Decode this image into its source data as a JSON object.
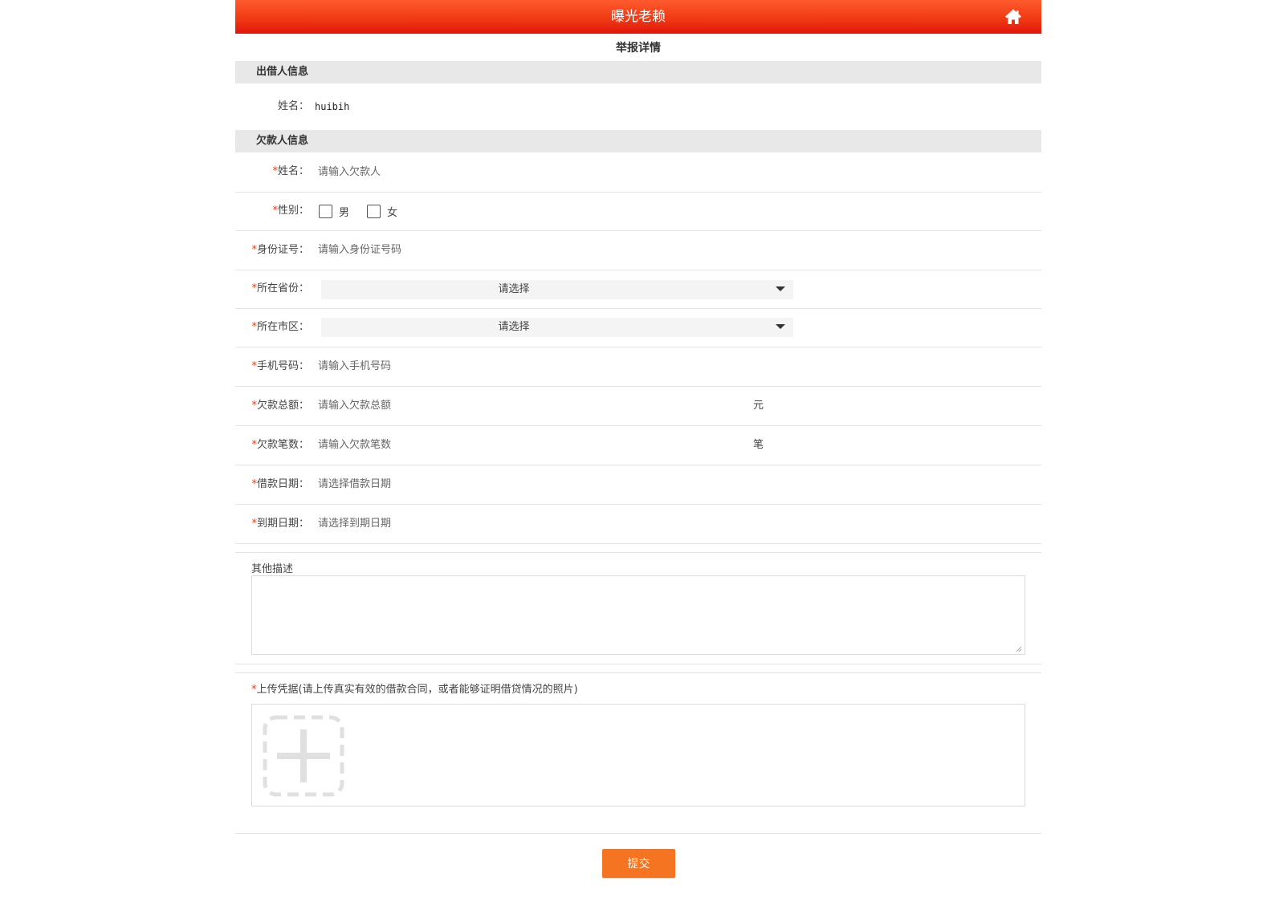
{
  "header": {
    "title": "曝光老赖",
    "home_icon": "home-icon",
    "gradient_colors": [
      "#ff5a2e",
      "#e0160e"
    ]
  },
  "subtitle": "举报详情",
  "lender_section": {
    "heading": "出借人信息",
    "name_label": "姓名：",
    "name_value": "huibih"
  },
  "debtor_section": {
    "heading": "欠款人信息",
    "required_mark": "*",
    "fields": {
      "name": {
        "label": "姓名：",
        "placeholder": "请输入欠款人"
      },
      "gender": {
        "label": "性别：",
        "options": [
          "男",
          "女"
        ]
      },
      "id_number": {
        "label": "身份证号：",
        "placeholder": "请输入身份证号码"
      },
      "province": {
        "label": "所在省份：",
        "selected": "请选择"
      },
      "city": {
        "label": "所在市区：",
        "selected": "请选择"
      },
      "phone": {
        "label": "手机号码：",
        "placeholder": "请输入手机号码"
      },
      "total_amount": {
        "label": "欠款总额：",
        "placeholder": "请输入欠款总额",
        "unit": "元"
      },
      "count": {
        "label": "欠款笔数：",
        "placeholder": "请输入欠款笔数",
        "unit": "笔"
      },
      "loan_date": {
        "label": "借款日期：",
        "placeholder": "请选择借款日期"
      },
      "due_date": {
        "label": "到期日期：",
        "placeholder": "请选择到期日期"
      }
    }
  },
  "description": {
    "label": "其他描述",
    "value": ""
  },
  "upload": {
    "label": "上传凭据(请上传真实有效的借款合同，或者能够证明借贷情况的照片)",
    "add_icon": "add-image-icon"
  },
  "submit_label": "提交",
  "colors": {
    "accent": "#f47421",
    "required": "#e53e1e",
    "section_bg": "#e8e8e8"
  }
}
